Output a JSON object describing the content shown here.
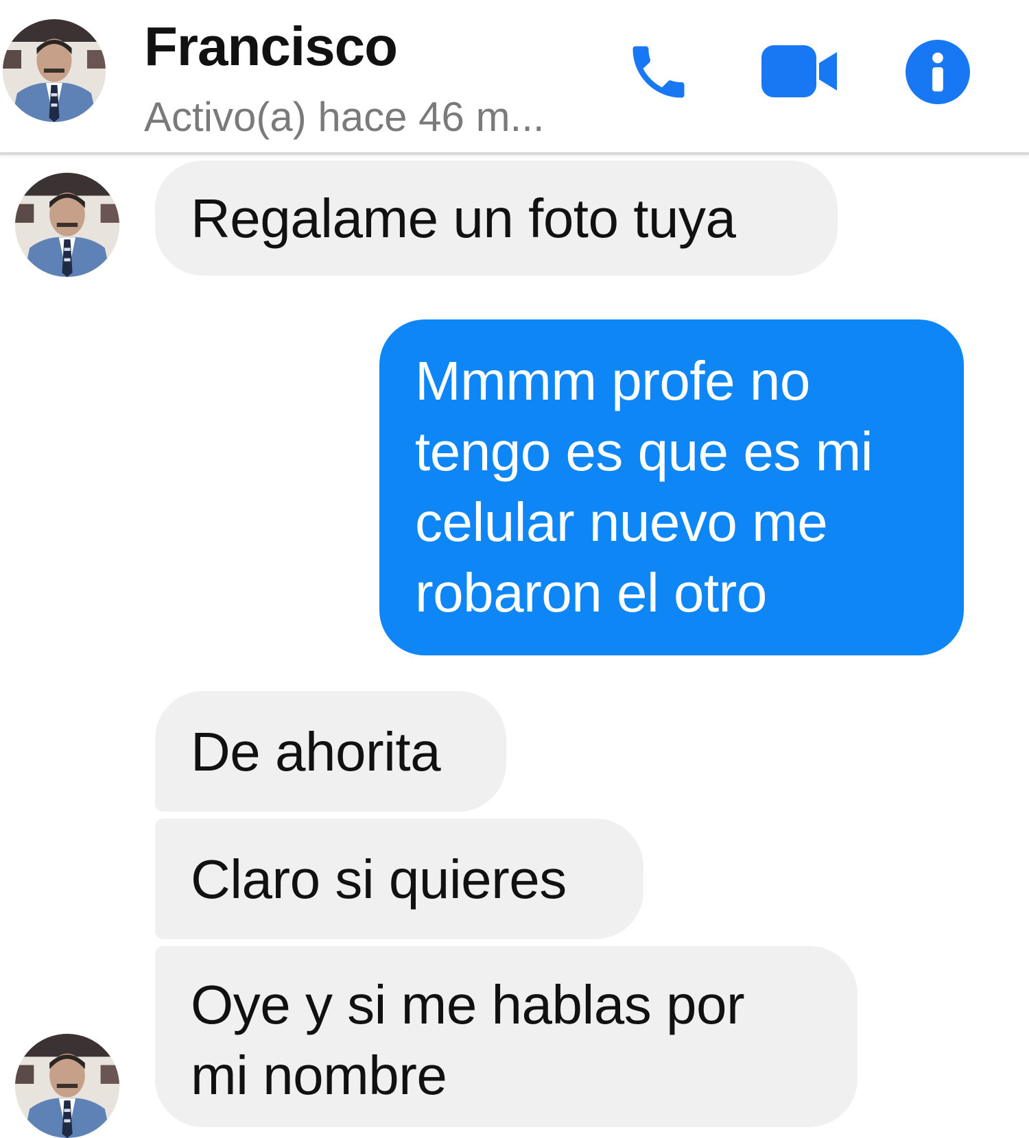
{
  "header": {
    "contact_name": "Francisco",
    "status": "Activo(a) hace 46 m...",
    "icons": {
      "call": "phone-icon",
      "video": "video-camera-icon",
      "info": "info-icon"
    },
    "accent_color": "#1877f2"
  },
  "messages": [
    {
      "direction": "incoming",
      "text": "Regalame un foto tuya"
    },
    {
      "direction": "outgoing",
      "lines": [
        "Mmmm profe no",
        "tengo es que es mi",
        "celular nuevo me",
        "robaron el otro"
      ]
    },
    {
      "direction": "incoming",
      "text": "De ahorita"
    },
    {
      "direction": "incoming",
      "text": "Claro si quieres"
    },
    {
      "direction": "incoming",
      "lines": [
        "Oye y si me hablas por",
        "mi nombre"
      ]
    }
  ],
  "colors": {
    "incoming_bubble": "#f1f0f0",
    "outgoing_bubble": "#0f86f5",
    "status_text": "#7a7a7a"
  }
}
